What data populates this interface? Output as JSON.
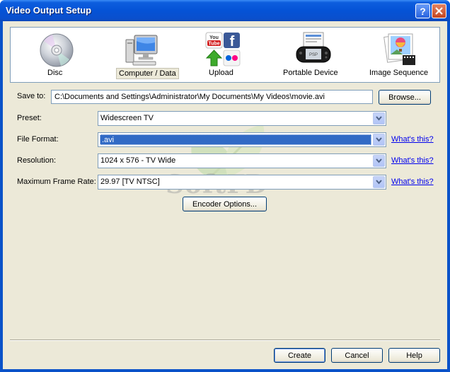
{
  "window": {
    "title": "Video Output Setup"
  },
  "strip": {
    "items": [
      {
        "label": "Disc",
        "icon": "disc-icon"
      },
      {
        "label": "Computer / Data",
        "icon": "computer-icon",
        "selected": true
      },
      {
        "label": "Upload",
        "icon": "upload-icon"
      },
      {
        "label": "Portable Device",
        "icon": "psp-icon"
      },
      {
        "label": "Image Sequence",
        "icon": "image-sequence-icon"
      }
    ]
  },
  "form": {
    "save_to_label": "Save to:",
    "save_to_value": "C:\\Documents and Settings\\Administrator\\My Documents\\My Videos\\movie.avi",
    "browse_label": "Browse...",
    "preset_label": "Preset:",
    "preset_value": "Widescreen TV",
    "format_label": "File Format:",
    "format_value": ".avi",
    "resolution_label": "Resolution:",
    "resolution_value": "1024 x 576 - TV Wide",
    "framerate_label": "Maximum Frame Rate:",
    "framerate_value": "29.97 [TV NTSC]",
    "whats_this": "What's this?",
    "encoder_label": "Encoder Options..."
  },
  "watermark": {
    "text": "SoftFD"
  },
  "footer": {
    "create_label": "Create",
    "cancel_label": "Cancel",
    "help_label": "Help"
  },
  "colors": {
    "titlebar": "#0553d6",
    "client_bg": "#ece9d8",
    "selection": "#316ac5",
    "link": "#0000ee"
  }
}
